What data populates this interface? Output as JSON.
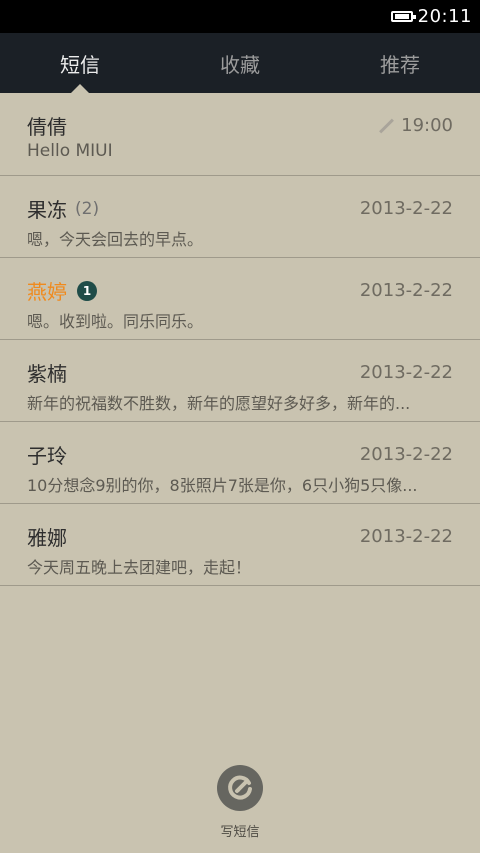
{
  "status_bar": {
    "time": "20:11",
    "battery_icon": "battery-icon"
  },
  "tabs": [
    {
      "label": "短信",
      "active": true
    },
    {
      "label": "收藏",
      "active": false
    },
    {
      "label": "推荐",
      "active": false
    }
  ],
  "conversations": [
    {
      "name": "倩倩",
      "count": "",
      "unread_badge": "",
      "time": "19:00",
      "draft": true,
      "preview": "Hello MIUI"
    },
    {
      "name": "果冻",
      "count": "(2)",
      "unread_badge": "",
      "time": "2013-2-22",
      "draft": false,
      "preview": "嗯，今天会回去的早点。"
    },
    {
      "name": "燕婷",
      "count": "",
      "unread_badge": "1",
      "time": "2013-2-22",
      "draft": false,
      "preview": "嗯。收到啦。同乐同乐。"
    },
    {
      "name": "紫楠",
      "count": "",
      "unread_badge": "",
      "time": "2013-2-22",
      "draft": false,
      "preview": "新年的祝福数不胜数，新年的愿望好多好多，新年的..."
    },
    {
      "name": "子玲",
      "count": "",
      "unread_badge": "",
      "time": "2013-2-22",
      "draft": false,
      "preview": "10分想念9别的你，8张照片7张是你，6只小狗5只像..."
    },
    {
      "name": "雅娜",
      "count": "",
      "unread_badge": "",
      "time": "2013-2-22",
      "draft": false,
      "preview": "今天周五晚上去团建吧，走起！"
    }
  ],
  "compose": {
    "label": "写短信",
    "icon": "compose-icon"
  },
  "colors": {
    "background": "#c9c3b0",
    "tabbar": "#1b2026",
    "unread_name": "#f08a1d",
    "badge": "#1f4c48"
  }
}
